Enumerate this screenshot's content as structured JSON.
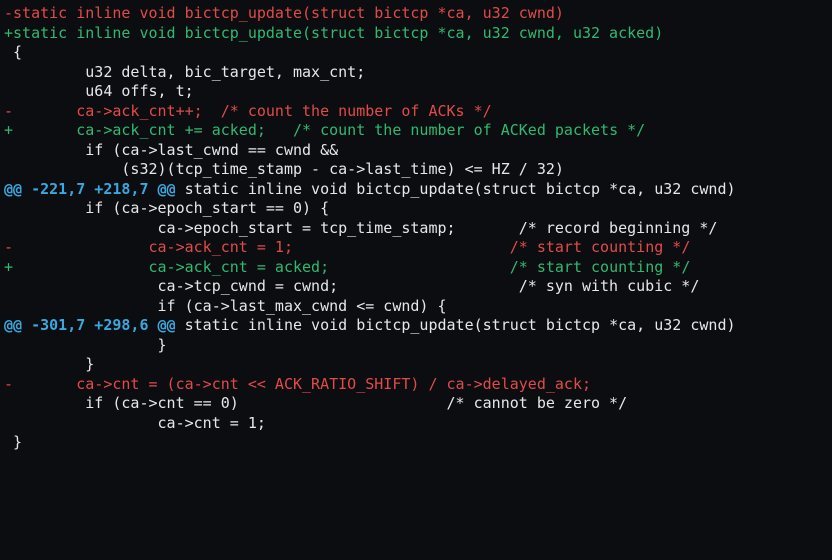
{
  "diff": {
    "lines": [
      {
        "segs": [
          {
            "cls": "seg-minus",
            "t": "-"
          },
          {
            "cls": "seg-del",
            "t": "static inline void bictcp_update(struct bictcp *ca, u32 cwnd)"
          }
        ]
      },
      {
        "segs": [
          {
            "cls": "seg-plus",
            "t": "+"
          },
          {
            "cls": "seg-add",
            "t": "static inline void bictcp_update(struct bictcp *ca, u32 cwnd, u32 acked)"
          }
        ]
      },
      {
        "segs": [
          {
            "cls": "seg-ctxmark",
            "t": " "
          },
          {
            "cls": "seg-ctx",
            "t": "{"
          }
        ]
      },
      {
        "segs": [
          {
            "cls": "seg-ctxmark",
            "t": " "
          },
          {
            "cls": "seg-ctx",
            "t": "        u32 delta, bic_target, max_cnt;"
          }
        ]
      },
      {
        "segs": [
          {
            "cls": "seg-ctxmark",
            "t": " "
          },
          {
            "cls": "seg-ctx",
            "t": "        u64 offs, t;"
          }
        ]
      },
      {
        "segs": [
          {
            "cls": "seg-ctxmark",
            "t": ""
          },
          {
            "cls": "seg-ctx",
            "t": ""
          }
        ]
      },
      {
        "segs": [
          {
            "cls": "seg-minus",
            "t": "-"
          },
          {
            "cls": "seg-ctx",
            "t": "       "
          },
          {
            "cls": "seg-del",
            "t": "ca->ack_cnt++;  /* count the number of ACKs */"
          }
        ]
      },
      {
        "segs": [
          {
            "cls": "seg-plus",
            "t": "+"
          },
          {
            "cls": "seg-ctx",
            "t": "       "
          },
          {
            "cls": "seg-add",
            "t": "ca->ack_cnt += acked;   /* count the number of ACKed packets */"
          }
        ]
      },
      {
        "segs": [
          {
            "cls": "seg-ctxmark",
            "t": ""
          },
          {
            "cls": "seg-ctx",
            "t": ""
          }
        ]
      },
      {
        "segs": [
          {
            "cls": "seg-ctxmark",
            "t": " "
          },
          {
            "cls": "seg-ctx",
            "t": "        if (ca->last_cwnd == cwnd &&"
          }
        ]
      },
      {
        "segs": [
          {
            "cls": "seg-ctxmark",
            "t": " "
          },
          {
            "cls": "seg-ctx",
            "t": "            (s32)(tcp_time_stamp - ca->last_time) <= HZ / 32)"
          }
        ]
      },
      {
        "segs": [
          {
            "cls": "seg-hunk",
            "t": "@@ -221,7 +218,7 @@"
          },
          {
            "cls": "seg-hunktxt",
            "t": " static inline void bictcp_update(struct bictcp *ca, u32 cwnd)"
          }
        ]
      },
      {
        "segs": [
          {
            "cls": "seg-ctxmark",
            "t": ""
          },
          {
            "cls": "seg-ctx",
            "t": ""
          }
        ]
      },
      {
        "segs": [
          {
            "cls": "seg-ctxmark",
            "t": " "
          },
          {
            "cls": "seg-ctx",
            "t": "        if (ca->epoch_start == 0) {"
          }
        ]
      },
      {
        "segs": [
          {
            "cls": "seg-ctxmark",
            "t": " "
          },
          {
            "cls": "seg-ctx",
            "t": "                ca->epoch_start = tcp_time_stamp;       /* record beginning */"
          }
        ]
      },
      {
        "segs": [
          {
            "cls": "seg-minus",
            "t": "-"
          },
          {
            "cls": "seg-ctx",
            "t": "               "
          },
          {
            "cls": "seg-del",
            "t": "ca->ack_cnt = 1;"
          },
          {
            "cls": "seg-ctx",
            "t": "                        "
          },
          {
            "cls": "seg-del",
            "t": "/* start counting */"
          }
        ]
      },
      {
        "segs": [
          {
            "cls": "seg-plus",
            "t": "+"
          },
          {
            "cls": "seg-ctx",
            "t": "               "
          },
          {
            "cls": "seg-add",
            "t": "ca->ack_cnt = acked;"
          },
          {
            "cls": "seg-ctx",
            "t": "                    "
          },
          {
            "cls": "seg-add",
            "t": "/* start counting */"
          }
        ]
      },
      {
        "segs": [
          {
            "cls": "seg-ctxmark",
            "t": " "
          },
          {
            "cls": "seg-ctx",
            "t": "                ca->tcp_cwnd = cwnd;                    /* syn with cubic */"
          }
        ]
      },
      {
        "segs": [
          {
            "cls": "seg-ctxmark",
            "t": ""
          },
          {
            "cls": "seg-ctx",
            "t": ""
          }
        ]
      },
      {
        "segs": [
          {
            "cls": "seg-ctxmark",
            "t": " "
          },
          {
            "cls": "seg-ctx",
            "t": "                if (ca->last_max_cwnd <= cwnd) {"
          }
        ]
      },
      {
        "segs": [
          {
            "cls": "seg-hunk",
            "t": "@@ -301,7 +298,6 @@"
          },
          {
            "cls": "seg-hunktxt",
            "t": " static inline void bictcp_update(struct bictcp *ca, u32 cwnd)"
          }
        ]
      },
      {
        "segs": [
          {
            "cls": "seg-ctxmark",
            "t": " "
          },
          {
            "cls": "seg-ctx",
            "t": "                }"
          }
        ]
      },
      {
        "segs": [
          {
            "cls": "seg-ctxmark",
            "t": " "
          },
          {
            "cls": "seg-ctx",
            "t": "        }"
          }
        ]
      },
      {
        "segs": [
          {
            "cls": "seg-ctxmark",
            "t": ""
          },
          {
            "cls": "seg-ctx",
            "t": ""
          }
        ]
      },
      {
        "segs": [
          {
            "cls": "seg-minus",
            "t": "-"
          },
          {
            "cls": "seg-ctx",
            "t": "       "
          },
          {
            "cls": "seg-del",
            "t": "ca->cnt = (ca->cnt << ACK_RATIO_SHIFT) / ca->delayed_ack;"
          }
        ]
      },
      {
        "segs": [
          {
            "cls": "seg-ctxmark",
            "t": " "
          },
          {
            "cls": "seg-ctx",
            "t": "        if (ca->cnt == 0)                       /* cannot be zero */"
          }
        ]
      },
      {
        "segs": [
          {
            "cls": "seg-ctxmark",
            "t": " "
          },
          {
            "cls": "seg-ctx",
            "t": "                ca->cnt = 1;"
          }
        ]
      },
      {
        "segs": [
          {
            "cls": "seg-ctxmark",
            "t": " "
          },
          {
            "cls": "seg-ctx",
            "t": "}"
          }
        ]
      }
    ]
  }
}
